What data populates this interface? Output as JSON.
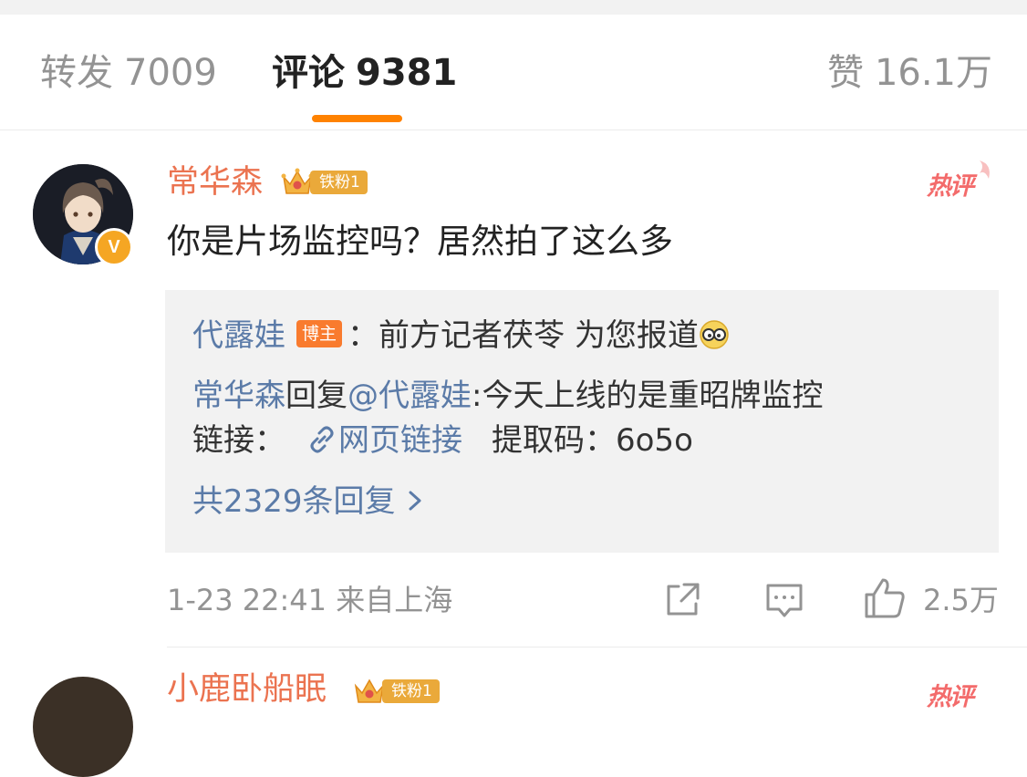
{
  "tabs": {
    "repost": {
      "label": "转发",
      "count": "7009"
    },
    "comments": {
      "label": "评论",
      "count": "9381"
    },
    "likes": {
      "label": "赞",
      "count": "16.1万"
    }
  },
  "comment": {
    "username": "常华森",
    "fan_badge": "铁粉1",
    "hot_label": "热评",
    "text": "你是片场监控吗？居然拍了这么多",
    "replies": {
      "first": {
        "user": "代露娃",
        "badge": "博主",
        "separator": "：",
        "text": "前方记者茯苓 为您报道",
        "emoji": "glasses-emoji"
      },
      "second": {
        "user": "常华森",
        "action": "回复",
        "mention": "@代露娃",
        "text": ":今天上线的是重昭牌监控",
        "link_prefix": "链接：",
        "link_text": "网页链接",
        "code_label": "提取码：",
        "code": "6o5o"
      },
      "total_label": "共2329条回复"
    },
    "time": "1-23 22:41",
    "location": "来自上海",
    "like_count": "2.5万"
  },
  "next_comment": {
    "username": "小鹿卧船眠",
    "fan_badge": "铁粉1",
    "hot_label": "热评"
  },
  "colors": {
    "accent": "#ff8200",
    "username": "#eb7350",
    "link": "#5b7ba8",
    "hot": "#f36b6b"
  }
}
